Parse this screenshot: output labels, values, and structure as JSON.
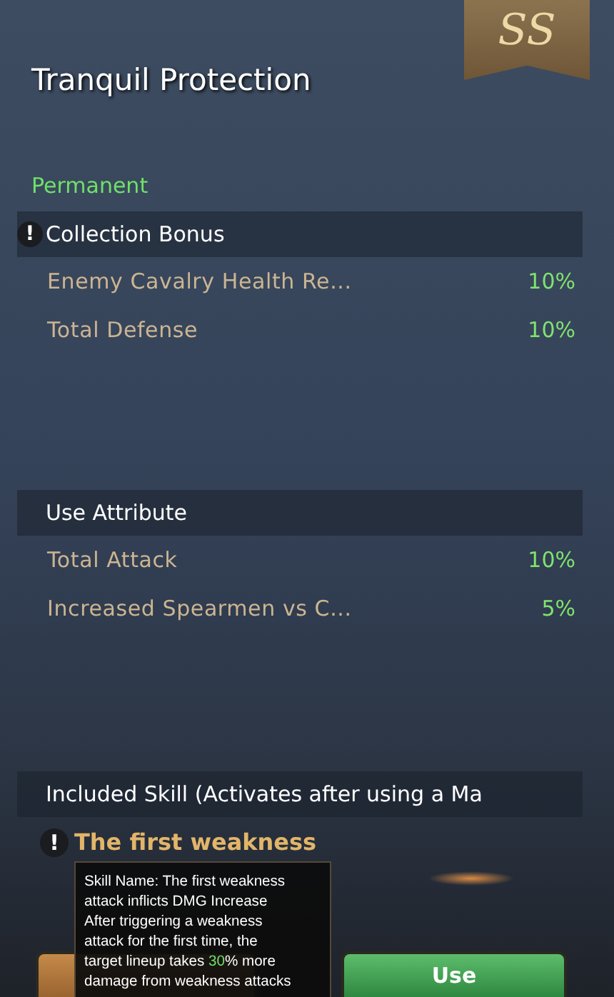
{
  "badge": "SS",
  "title": "Tranquil Protection",
  "duration": "Permanent",
  "sections": [
    {
      "heading": "Collection Bonus",
      "info_mark": "!",
      "rows": [
        {
          "label": "Enemy Cavalry Health Re...",
          "value": "10%"
        },
        {
          "label": "Total Defense",
          "value": "10%"
        }
      ]
    },
    {
      "heading": "Use Attribute",
      "rows": [
        {
          "label": "Total Attack",
          "value": "10%"
        },
        {
          "label": "Increased Spearmen vs C...",
          "value": "5%"
        }
      ]
    }
  ],
  "skill": {
    "heading": "Included Skill (Activates after using a Ma",
    "info_mark": "!",
    "name": "The first weakness"
  },
  "tooltip": {
    "before": "Skill Name: The first weakness\nattack inflicts DMG Increase\nAfter triggering a weakness\nattack for the first time, the\ntarget lineup takes ",
    "highlight": "30",
    "after": "% more\ndamage from weakness attacks"
  },
  "buttons": [
    {
      "kind": "secondary"
    },
    {
      "kind": "primary",
      "label": "Use"
    }
  ]
}
